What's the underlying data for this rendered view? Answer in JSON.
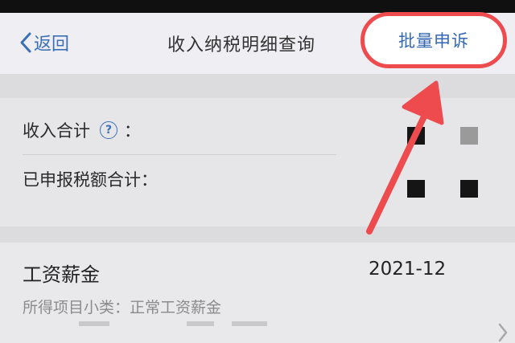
{
  "nav": {
    "back_label": "返回",
    "title": "收入纳税明细查询",
    "appeal_label": "批量申诉"
  },
  "summary": {
    "income_total_label": "收入合计",
    "income_total_colon": "：",
    "help_glyph": "?",
    "tax_total_label": "已申报税额合计："
  },
  "record": {
    "title": "工资薪金",
    "date": "2021-12",
    "subtype_label": "所得项目小类：",
    "subtype_value": "正常工资薪金"
  },
  "colors": {
    "accent_blue": "#3b6fb6",
    "highlight_red": "#ee4b4e"
  },
  "icons": {
    "back": "chevron-left-icon",
    "help": "question-circle-icon",
    "row": "chevron-right-icon",
    "annotation": "red-arrow-icon"
  }
}
